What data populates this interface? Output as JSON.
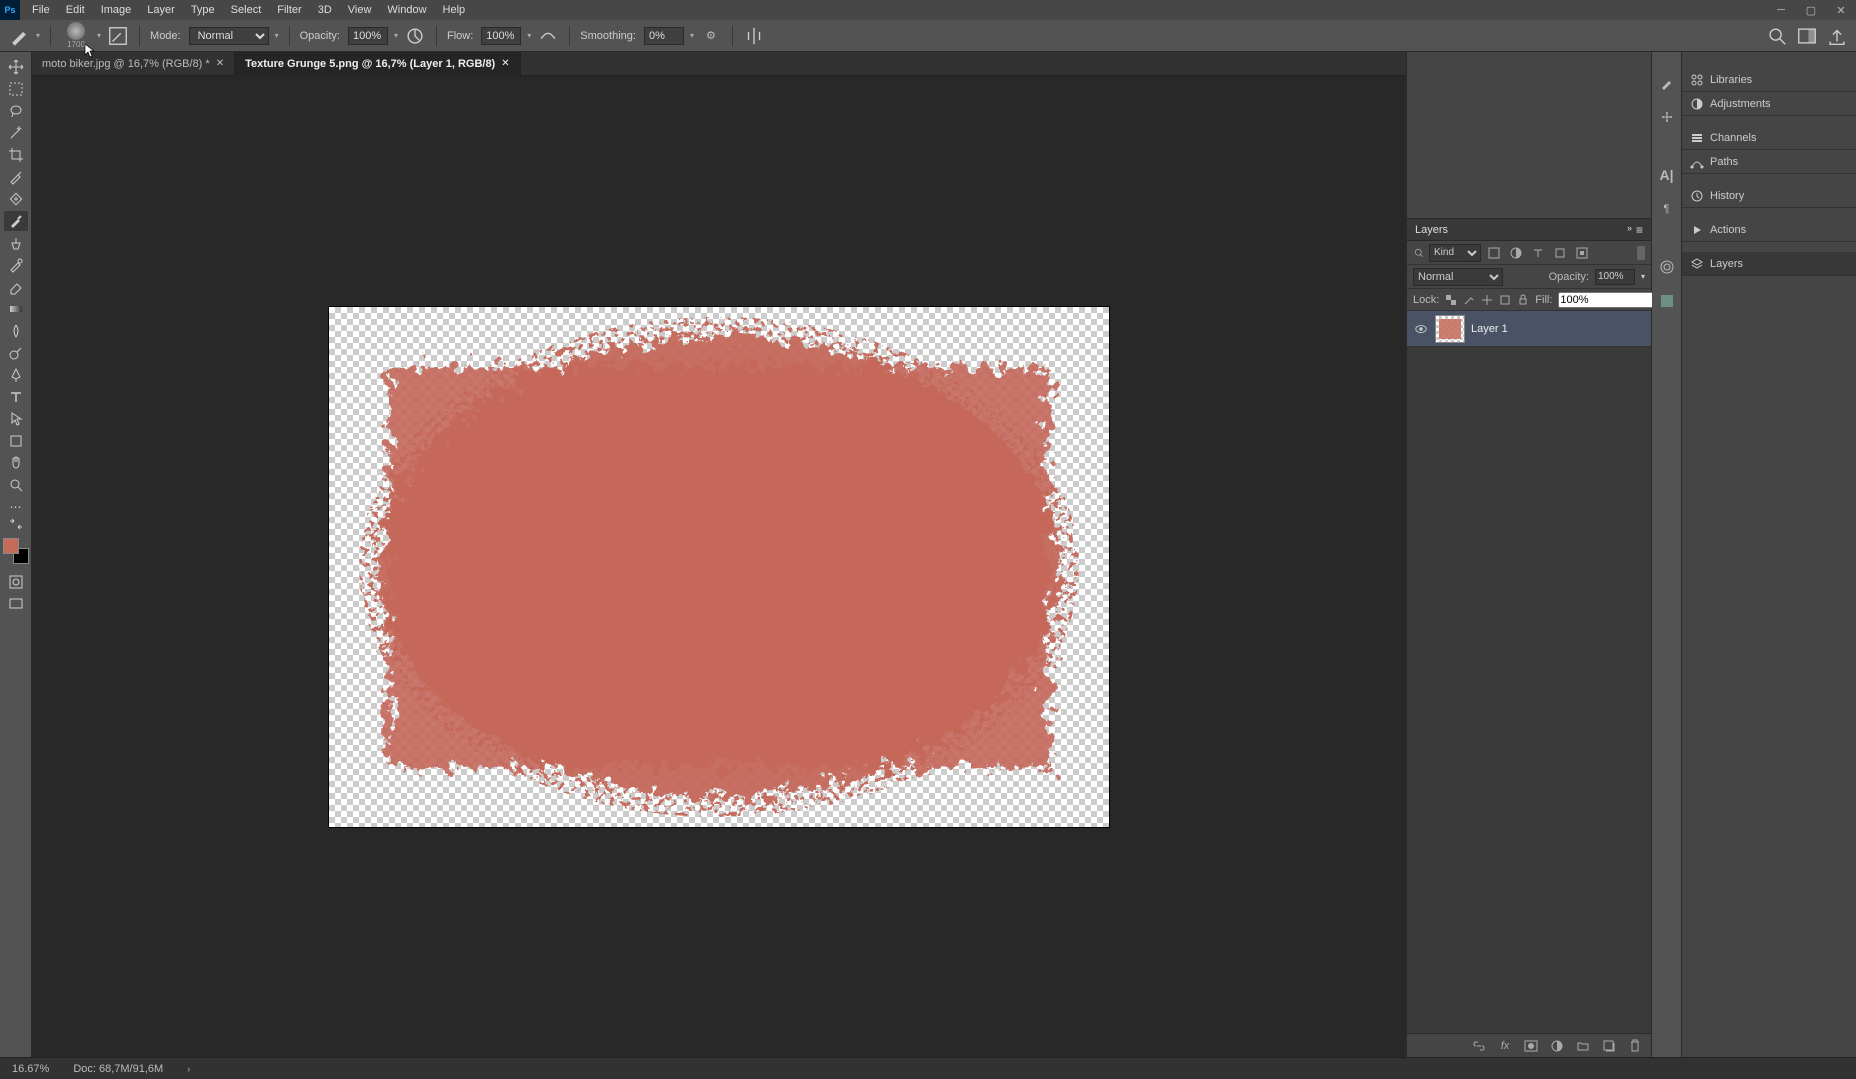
{
  "menu": {
    "file": "File",
    "edit": "Edit",
    "image": "Image",
    "layer": "Layer",
    "type": "Type",
    "select": "Select",
    "filter": "Filter",
    "threeD": "3D",
    "view": "View",
    "window": "Window",
    "help": "Help"
  },
  "options": {
    "brush_size": "1700",
    "mode_label": "Mode:",
    "mode_value": "Normal",
    "opacity_label": "Opacity:",
    "opacity_value": "100%",
    "flow_label": "Flow:",
    "flow_value": "100%",
    "smoothing_label": "Smoothing:",
    "smoothing_value": "0%"
  },
  "tabs": [
    {
      "label": "moto biker.jpg @ 16,7% (RGB/8) *"
    },
    {
      "label": "Texture Grunge 5.png @ 16,7% (Layer 1, RGB/8)"
    }
  ],
  "panels": {
    "libraries": "Libraries",
    "adjustments": "Adjustments",
    "channels": "Channels",
    "paths": "Paths",
    "history": "History",
    "actions": "Actions",
    "layers": "Layers"
  },
  "layers": {
    "title": "Layers",
    "filter_kind": "Kind",
    "blend_mode": "Normal",
    "opacity_label": "Opacity:",
    "opacity_value": "100%",
    "lock_label": "Lock:",
    "fill_label": "Fill:",
    "fill_value": "100%",
    "items": [
      {
        "name": "Layer 1"
      }
    ]
  },
  "status": {
    "zoom": "16.67%",
    "doc_info": "Doc: 68,7M/91,6M"
  },
  "colors": {
    "fg": "#c56b5a",
    "bg": "#000000"
  }
}
